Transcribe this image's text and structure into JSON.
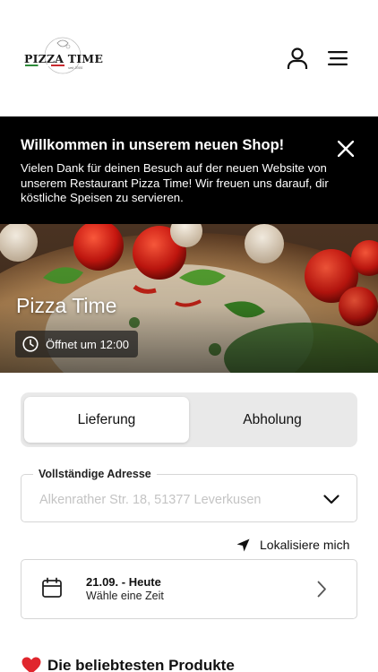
{
  "header": {
    "logo_text": "PIZZA TIME",
    "logo_sub": "seit 2005",
    "user_icon": "user-icon",
    "menu_icon": "menu-icon"
  },
  "banner": {
    "title": "Willkommen in unserem neuen Shop!",
    "text": "Vielen Dank für deinen Besuch auf der neuen Website von unserem Restaurant Pizza Time! Wir freuen uns darauf, dir köstliche Speisen zu servieren.",
    "close_icon": "close-icon"
  },
  "hero": {
    "title": "Pizza Time",
    "opening": "Öffnet um 12:00",
    "clock_icon": "clock-icon"
  },
  "order_mode": {
    "options": [
      "Lieferung",
      "Abholung"
    ],
    "selected": "Lieferung"
  },
  "address": {
    "label": "Vollständige Adresse",
    "placeholder": "Alkenrather Str. 18, 51377 Leverkusen",
    "chevron_icon": "chevron-down-icon"
  },
  "locate": {
    "label": "Lokalisiere mich",
    "icon": "location-arrow-icon"
  },
  "time": {
    "date": "21.09. - Heute",
    "subtitle": "Wähle eine Zeit",
    "icon": "calendar-icon"
  },
  "popular": {
    "title": "Die beliebtesten Produkte",
    "icon": "heart-icon"
  },
  "colors": {
    "banner_bg": "#000000",
    "accent_red": "#e0262d",
    "toggle_bg": "#e9e9e9",
    "border": "#d6d6d6"
  }
}
